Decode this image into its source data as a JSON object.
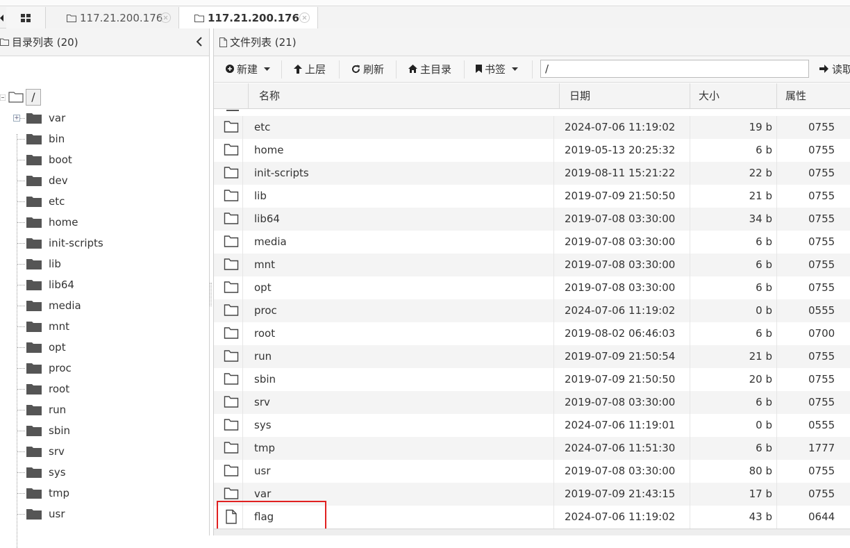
{
  "tabs": {
    "items": [
      {
        "label": "117.21.200.176"
      },
      {
        "label": "117.21.200.176"
      }
    ]
  },
  "left_panel": {
    "title": "目录列表 (20)",
    "root_label": "/",
    "items": [
      {
        "label": "var"
      },
      {
        "label": "bin"
      },
      {
        "label": "boot"
      },
      {
        "label": "dev"
      },
      {
        "label": "etc"
      },
      {
        "label": "home"
      },
      {
        "label": "init-scripts"
      },
      {
        "label": "lib"
      },
      {
        "label": "lib64"
      },
      {
        "label": "media"
      },
      {
        "label": "mnt"
      },
      {
        "label": "opt"
      },
      {
        "label": "proc"
      },
      {
        "label": "root"
      },
      {
        "label": "run"
      },
      {
        "label": "sbin"
      },
      {
        "label": "srv"
      },
      {
        "label": "sys"
      },
      {
        "label": "tmp"
      },
      {
        "label": "usr"
      }
    ]
  },
  "right_panel": {
    "title": "文件列表 (21)",
    "toolbar": {
      "new_label": "新建",
      "up_label": "上层",
      "refresh_label": "刷新",
      "home_label": "主目录",
      "bookmark_label": "书签",
      "path_value": "/",
      "read_label": "读取"
    },
    "columns": {
      "name": "名称",
      "date": "日期",
      "size": "大小",
      "attr": "属性"
    },
    "rows": [
      {
        "name": "etc",
        "date": "2024-07-06 11:19:02",
        "size": "19 b",
        "attr": "0755",
        "type": "folder-icon"
      },
      {
        "name": "home",
        "date": "2019-05-13 20:25:32",
        "size": "6 b",
        "attr": "0755",
        "type": "folder-icon"
      },
      {
        "name": "init-scripts",
        "date": "2019-08-11 15:21:22",
        "size": "22 b",
        "attr": "0755",
        "type": "folder-icon"
      },
      {
        "name": "lib",
        "date": "2019-07-09 21:50:50",
        "size": "21 b",
        "attr": "0755",
        "type": "folder-icon"
      },
      {
        "name": "lib64",
        "date": "2019-07-08 03:30:00",
        "size": "34 b",
        "attr": "0755",
        "type": "folder-icon"
      },
      {
        "name": "media",
        "date": "2019-07-08 03:30:00",
        "size": "6 b",
        "attr": "0755",
        "type": "folder-icon"
      },
      {
        "name": "mnt",
        "date": "2019-07-08 03:30:00",
        "size": "6 b",
        "attr": "0755",
        "type": "folder-icon"
      },
      {
        "name": "opt",
        "date": "2019-07-08 03:30:00",
        "size": "6 b",
        "attr": "0755",
        "type": "folder-icon"
      },
      {
        "name": "proc",
        "date": "2024-07-06 11:19:02",
        "size": "0 b",
        "attr": "0555",
        "type": "folder-icon"
      },
      {
        "name": "root",
        "date": "2019-08-02 06:46:03",
        "size": "6 b",
        "attr": "0700",
        "type": "folder-icon"
      },
      {
        "name": "run",
        "date": "2019-07-09 21:50:54",
        "size": "21 b",
        "attr": "0755",
        "type": "folder-icon"
      },
      {
        "name": "sbin",
        "date": "2019-07-09 21:50:50",
        "size": "20 b",
        "attr": "0755",
        "type": "folder-icon"
      },
      {
        "name": "srv",
        "date": "2019-07-08 03:30:00",
        "size": "6 b",
        "attr": "0755",
        "type": "folder-icon"
      },
      {
        "name": "sys",
        "date": "2024-07-06 11:19:01",
        "size": "0 b",
        "attr": "0555",
        "type": "folder-icon"
      },
      {
        "name": "tmp",
        "date": "2024-07-06 11:51:30",
        "size": "6 b",
        "attr": "1777",
        "type": "folder-icon"
      },
      {
        "name": "usr",
        "date": "2019-07-08 03:30:00",
        "size": "80 b",
        "attr": "0755",
        "type": "folder-icon"
      },
      {
        "name": "var",
        "date": "2019-07-09 21:43:15",
        "size": "17 b",
        "attr": "0755",
        "type": "folder-icon"
      },
      {
        "name": "flag",
        "date": "2024-07-06 11:19:02",
        "size": "43 b",
        "attr": "0644",
        "type": "file-icon"
      }
    ]
  },
  "colors": {
    "highlight": "#e02020",
    "folder_dark": "#555555",
    "row_alt": "#f4f4f4"
  }
}
